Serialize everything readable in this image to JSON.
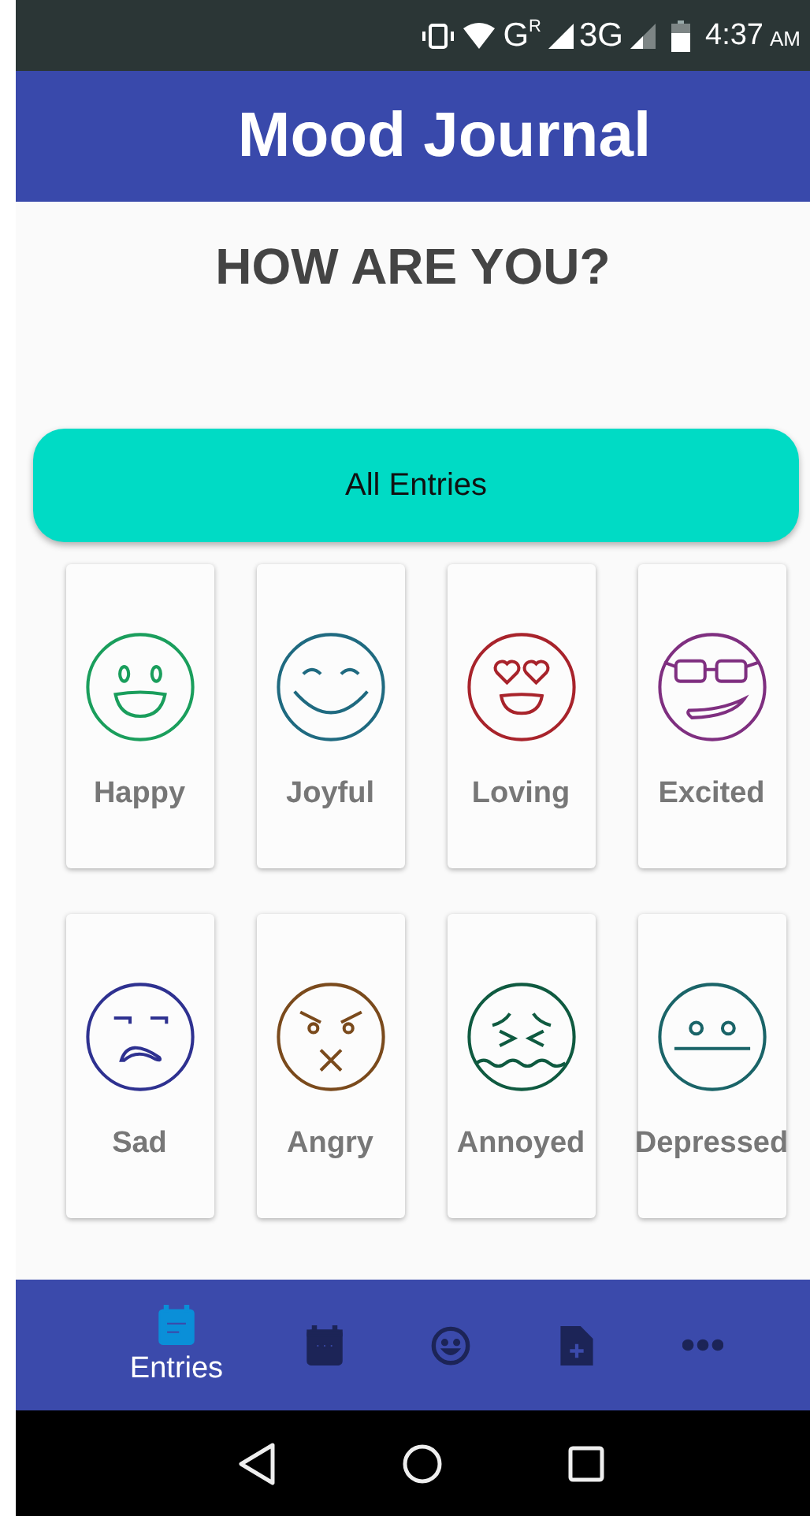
{
  "status_bar": {
    "network": "G",
    "roaming": "R",
    "data": "3G",
    "time": "4:37",
    "period": "AM"
  },
  "app_bar": {
    "title": "Mood Journal"
  },
  "heading": "HOW ARE YOU?",
  "all_entries_button": "All Entries",
  "moods": [
    {
      "label": "Happy",
      "kind": "happy",
      "color": "#1a9e5c"
    },
    {
      "label": "Joyful",
      "kind": "joyful",
      "color": "#1f6a80"
    },
    {
      "label": "Loving",
      "kind": "loving",
      "color": "#a8232b"
    },
    {
      "label": "Excited",
      "kind": "excited",
      "color": "#7f2f80"
    },
    {
      "label": "Sad",
      "kind": "sad",
      "color": "#2e3190"
    },
    {
      "label": "Angry",
      "kind": "angry",
      "color": "#7a4a1c"
    },
    {
      "label": "Annoyed",
      "kind": "annoyed",
      "color": "#0f5a40"
    },
    {
      "label": "Depressed",
      "kind": "depressed",
      "color": "#1a6468"
    }
  ],
  "bottom_nav": [
    {
      "kind": "entries",
      "label": "Entries",
      "selected": true
    },
    {
      "kind": "calendar",
      "selected": false
    },
    {
      "kind": "smiley",
      "selected": false
    },
    {
      "kind": "new-file",
      "selected": false
    },
    {
      "kind": "more",
      "selected": false
    }
  ]
}
